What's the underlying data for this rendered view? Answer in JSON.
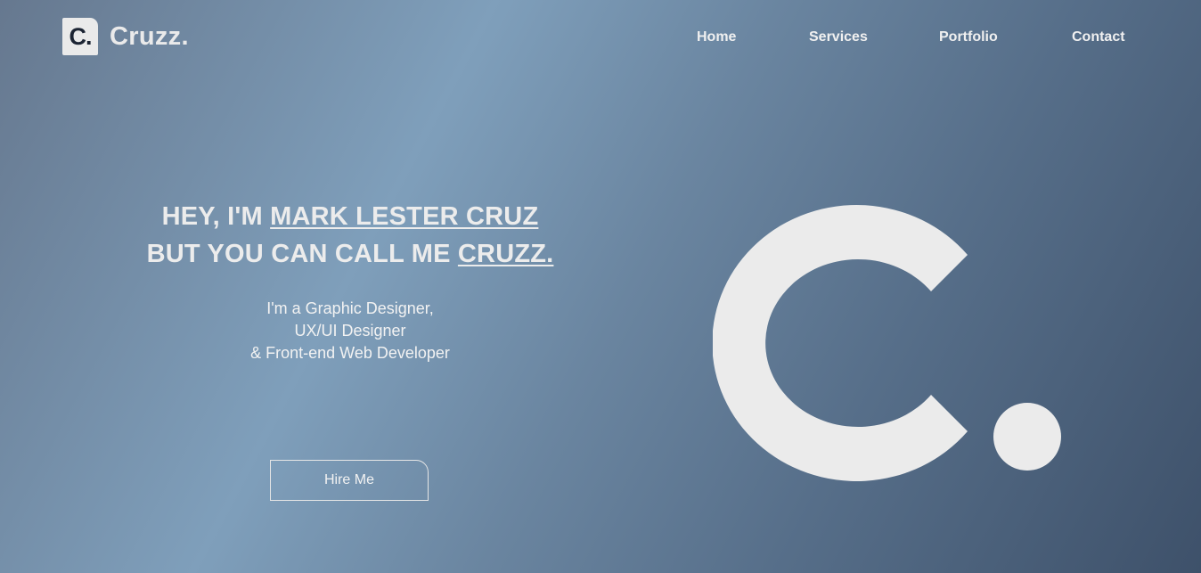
{
  "brand": {
    "mark": "C.",
    "name": "Cruzz."
  },
  "nav": {
    "items": [
      {
        "label": "Home"
      },
      {
        "label": "Services"
      },
      {
        "label": "Portfolio"
      },
      {
        "label": "Contact"
      }
    ]
  },
  "hero": {
    "line1_prefix": "HEY, I'M ",
    "line1_name": "MARK LESTER CRUZ",
    "line2_prefix": "BUT YOU CAN CALL ME ",
    "line2_nick": "CRUZZ.",
    "subtitle_lines": [
      "I'm a Graphic Designer,",
      "UX/UI Designer",
      "& Front-end Web Developer"
    ],
    "cta_label": "Hire Me"
  },
  "colors": {
    "logo_fill": "#ebebeb",
    "brand_dark": "#1c2433",
    "gradient_light": "#7f9fbb",
    "gradient_dark": "#3e516a"
  }
}
